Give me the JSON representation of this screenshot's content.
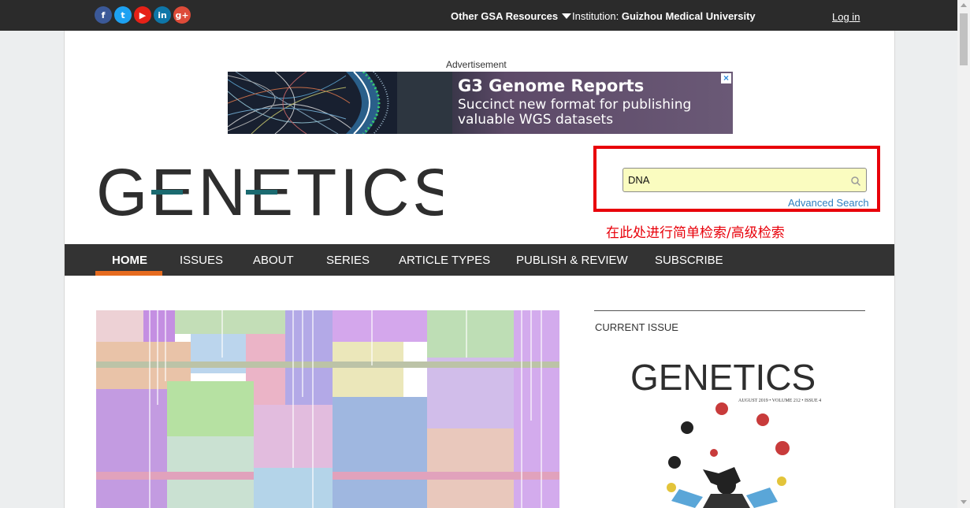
{
  "topbar": {
    "social": [
      {
        "icon": "facebook-icon",
        "glyph": "f",
        "color": "#3b5998"
      },
      {
        "icon": "twitter-icon",
        "glyph": "t",
        "color": "#1da1f2"
      },
      {
        "icon": "youtube-icon",
        "glyph": "▶",
        "color": "#e62117"
      },
      {
        "icon": "linkedin-icon",
        "glyph": "in",
        "color": "#0e76a8"
      },
      {
        "icon": "googleplus-icon",
        "glyph": "g+",
        "color": "#dd4b39"
      }
    ],
    "resources_label": "Other GSA Resources",
    "institution_prefix": "Institution: ",
    "institution_name": "Guizhou Medical University",
    "login_label": "Log in"
  },
  "ad": {
    "label": "Advertisement",
    "title": "G3 Genome Reports",
    "subtitle": "Succinct new format for publishing valuable WGS datasets",
    "close": "×"
  },
  "logo_text": "GENETICS",
  "search": {
    "value": "DNA",
    "advanced_label": "Advanced Search"
  },
  "annotation": "在此处进行简单检索/高级检索",
  "nav": {
    "items": [
      "HOME",
      "ISSUES",
      "ABOUT",
      "SERIES",
      "ARTICLE TYPES",
      "PUBLISH & REVIEW",
      "SUBSCRIBE"
    ],
    "active": "HOME"
  },
  "current_issue": {
    "label": "CURRENT ISSUE",
    "cover_title": "GENETICS",
    "cover_meta": "AUGUST 2019 • VOLUME 212 • ISSUE 4"
  },
  "colors": {
    "accent_orange": "#e66b1f",
    "annotation_red": "#e8000a",
    "logo_teal": "#1b6a70",
    "link_blue": "#2f7fbf"
  }
}
